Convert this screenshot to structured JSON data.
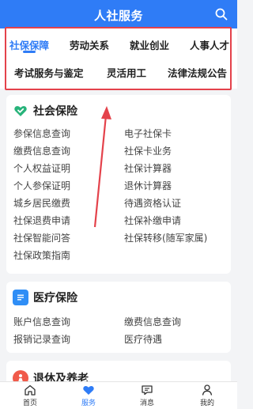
{
  "header": {
    "title": "人社服务",
    "search_icon": "search-icon"
  },
  "categories": {
    "row1": [
      "社保保障",
      "劳动关系",
      "就业创业",
      "人事人才"
    ],
    "row2": [
      "考试服务与鉴定",
      "灵活用工",
      "法律法规公告"
    ],
    "active": "社保保障",
    "accent": "#2f7cf6",
    "highlight_color": "#e4424b"
  },
  "social_insurance": {
    "title": "社会保险",
    "icon": "heart-shield-icon",
    "left": [
      "参保信息查询",
      "缴费信息查询",
      "个人权益证明",
      "个人参保证明",
      "城乡居民缴费",
      "社保退费申请",
      "社保智能问答",
      "社保政策指南"
    ],
    "right": [
      "电子社保卡",
      "社保卡业务",
      "社保计算器",
      "退休计算器",
      "待遇资格认证",
      "社保补缴申请",
      "社保转移(随军家属)"
    ]
  },
  "medical_insurance": {
    "title": "医疗保险",
    "icon": "document-icon",
    "left": [
      "账户信息查询",
      "报销记录查询"
    ],
    "right": [
      "缴费信息查询",
      "医疗待遇"
    ]
  },
  "retirement": {
    "title": "退休及养老",
    "icon": "elder-icon"
  },
  "bottom_nav": {
    "tabs": [
      {
        "label": "首页",
        "icon": "home-icon"
      },
      {
        "label": "服务",
        "icon": "heart-icon"
      },
      {
        "label": "消息",
        "icon": "message-icon"
      },
      {
        "label": "我的",
        "icon": "person-icon"
      }
    ],
    "active": "服务"
  }
}
